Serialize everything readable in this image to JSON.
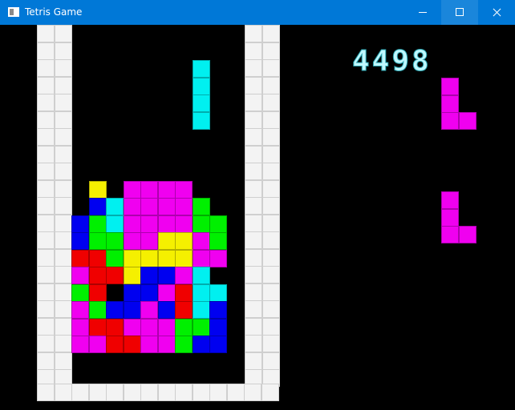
{
  "window": {
    "title": "Tetris Game"
  },
  "colors": {
    "Y": "#f5f000",
    "M": "#f000f0",
    "B": "#0000f0",
    "C": "#00f0f0",
    "G": "#00f000",
    "R": "#f00000"
  },
  "score": "4498",
  "board": {
    "cols": 10,
    "rows": 22,
    "cells": [
      "..........",
      "..........",
      "..........",
      ".........C",
      ".........C",
      ".........C",
      ".........C",
      "..........",
      "..........",
      "..........",
      "...Y.MMMM.",
      "...BCMMMMG",
      "..BGCMMMMGG",
      "..BGGMMYYMG",
      "..RRGYYYYMM",
      "..MRRYBBMC",
      "..GR.BBMRCC",
      "..MGBBMBRCB",
      "..MRRMMMGGB",
      "..MMRRMMGBB",
      "..........",
      ".........."
    ]
  },
  "next_pieces": [
    {
      "shape": "L",
      "color": "M"
    },
    {
      "shape": "L",
      "color": "M"
    }
  ]
}
